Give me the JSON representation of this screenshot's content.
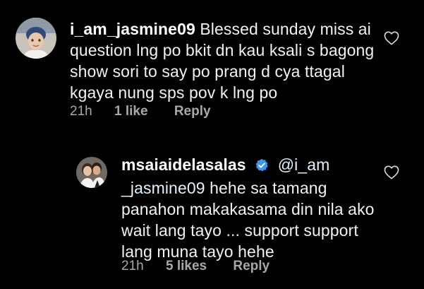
{
  "comments": [
    {
      "username": "i_am_jasmine09",
      "text": "Blessed sunday miss ai question lng po bkit dn kau ksali s bagong show sori to say po prang d cya ttagal kgaya nung sps pov k lng po",
      "time": "21h",
      "likes": "1 like",
      "reply_label": "Reply",
      "verified": false
    },
    {
      "username": "msaiaidelasalas",
      "mention": "@i_am _jasmine09",
      "text": "hehe sa tamang panahon makakasama din nila ako wait lang tayo ... support support lang muna tayo hehe",
      "time": "21h",
      "likes": "5 likes",
      "reply_label": "Reply",
      "verified": true
    }
  ],
  "colors": {
    "background": "#000000",
    "text": "#f2f2f2",
    "meta_text": "#a8a8a8",
    "verified_badge": "#3897f0",
    "mention": "#e0f1ff"
  },
  "icons": {
    "like": "heart-outline-icon",
    "verified": "verified-badge-icon"
  }
}
